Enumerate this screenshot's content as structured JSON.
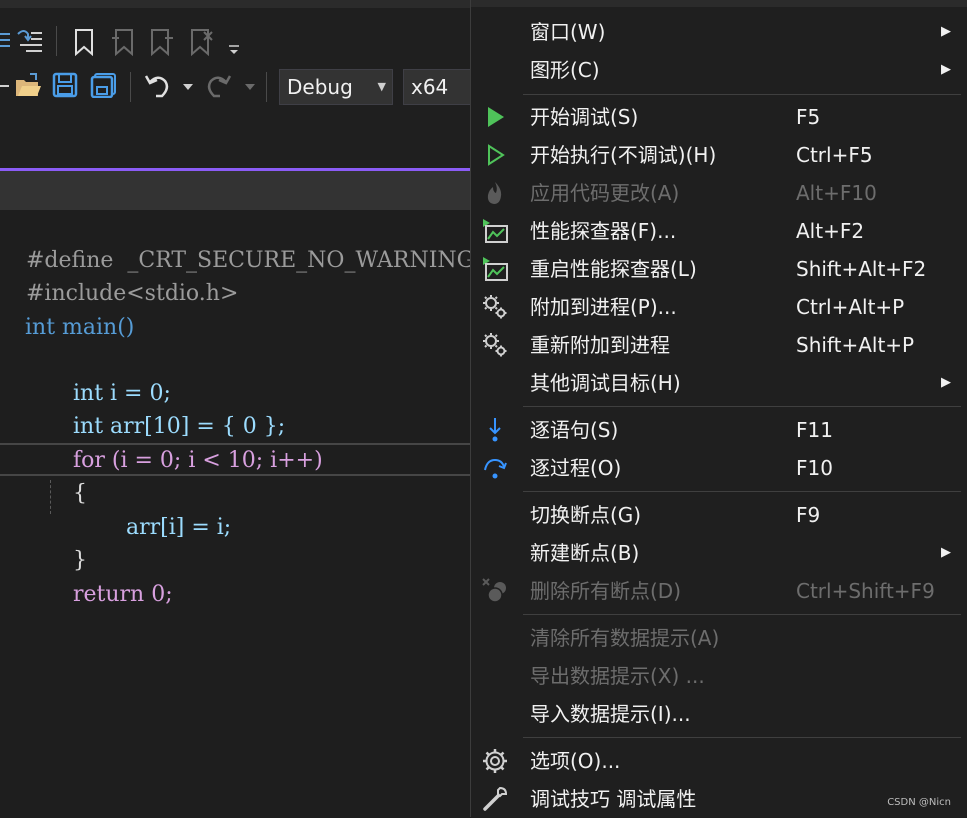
{
  "toolbar": {
    "config_value": "Debug",
    "platform_value": "x64"
  },
  "code": {
    "lines": [
      "#define  _CRT_SECURE_NO_WARNINGS",
      "#include<stdio.h>",
      "int main()",
      "int i = 0;",
      "int arr[10] = { 0 };",
      "for (i = 0; i < 10; i++)",
      "{",
      "arr[i] = i;",
      "}",
      "return 0;"
    ]
  },
  "menu": {
    "items": [
      {
        "label": "窗口(W)",
        "shortcut": "",
        "submenu": true,
        "enabled": true,
        "icon": ""
      },
      {
        "label": "图形(C)",
        "shortcut": "",
        "submenu": true,
        "enabled": true,
        "icon": ""
      },
      {
        "label": "开始调试(S)",
        "shortcut": "F5",
        "submenu": false,
        "enabled": true,
        "icon": "play-filled-icon"
      },
      {
        "label": "开始执行(不调试)(H)",
        "shortcut": "Ctrl+F5",
        "submenu": false,
        "enabled": true,
        "icon": "play-outline-icon"
      },
      {
        "label": "应用代码更改(A)",
        "shortcut": "Alt+F10",
        "submenu": false,
        "enabled": false,
        "icon": "flame-icon"
      },
      {
        "label": "性能探查器(F)...",
        "shortcut": "Alt+F2",
        "submenu": false,
        "enabled": true,
        "icon": "performance-profiler-icon"
      },
      {
        "label": "重启性能探查器(L)",
        "shortcut": "Shift+Alt+F2",
        "submenu": false,
        "enabled": true,
        "icon": "restart-profiler-icon"
      },
      {
        "label": "附加到进程(P)...",
        "shortcut": "Ctrl+Alt+P",
        "submenu": false,
        "enabled": true,
        "icon": "gears-icon"
      },
      {
        "label": "重新附加到进程",
        "shortcut": "Shift+Alt+P",
        "submenu": false,
        "enabled": true,
        "icon": "gears-icon"
      },
      {
        "label": "其他调试目标(H)",
        "shortcut": "",
        "submenu": true,
        "enabled": true,
        "icon": ""
      },
      {
        "label": "逐语句(S)",
        "shortcut": "F11",
        "submenu": false,
        "enabled": true,
        "icon": "step-into-icon"
      },
      {
        "label": "逐过程(O)",
        "shortcut": "F10",
        "submenu": false,
        "enabled": true,
        "icon": "step-over-icon"
      },
      {
        "label": "切换断点(G)",
        "shortcut": "F9",
        "submenu": false,
        "enabled": true,
        "icon": ""
      },
      {
        "label": "新建断点(B)",
        "shortcut": "",
        "submenu": true,
        "enabled": true,
        "icon": ""
      },
      {
        "label": "删除所有断点(D)",
        "shortcut": "Ctrl+Shift+F9",
        "submenu": false,
        "enabled": false,
        "icon": "delete-breakpoints-icon"
      },
      {
        "label": "清除所有数据提示(A)",
        "shortcut": "",
        "submenu": false,
        "enabled": false,
        "icon": ""
      },
      {
        "label": "导出数据提示(X) ...",
        "shortcut": "",
        "submenu": false,
        "enabled": false,
        "icon": ""
      },
      {
        "label": "导入数据提示(I)...",
        "shortcut": "",
        "submenu": false,
        "enabled": true,
        "icon": ""
      },
      {
        "label": "选项(O)...",
        "shortcut": "",
        "submenu": false,
        "enabled": true,
        "icon": "gear-icon"
      },
      {
        "label": "调试技巧 调试属性",
        "shortcut": "",
        "submenu": false,
        "enabled": true,
        "icon": "wrench-icon"
      }
    ],
    "submenu_glyph": "▶"
  },
  "watermark": "CSDN @Nicn"
}
